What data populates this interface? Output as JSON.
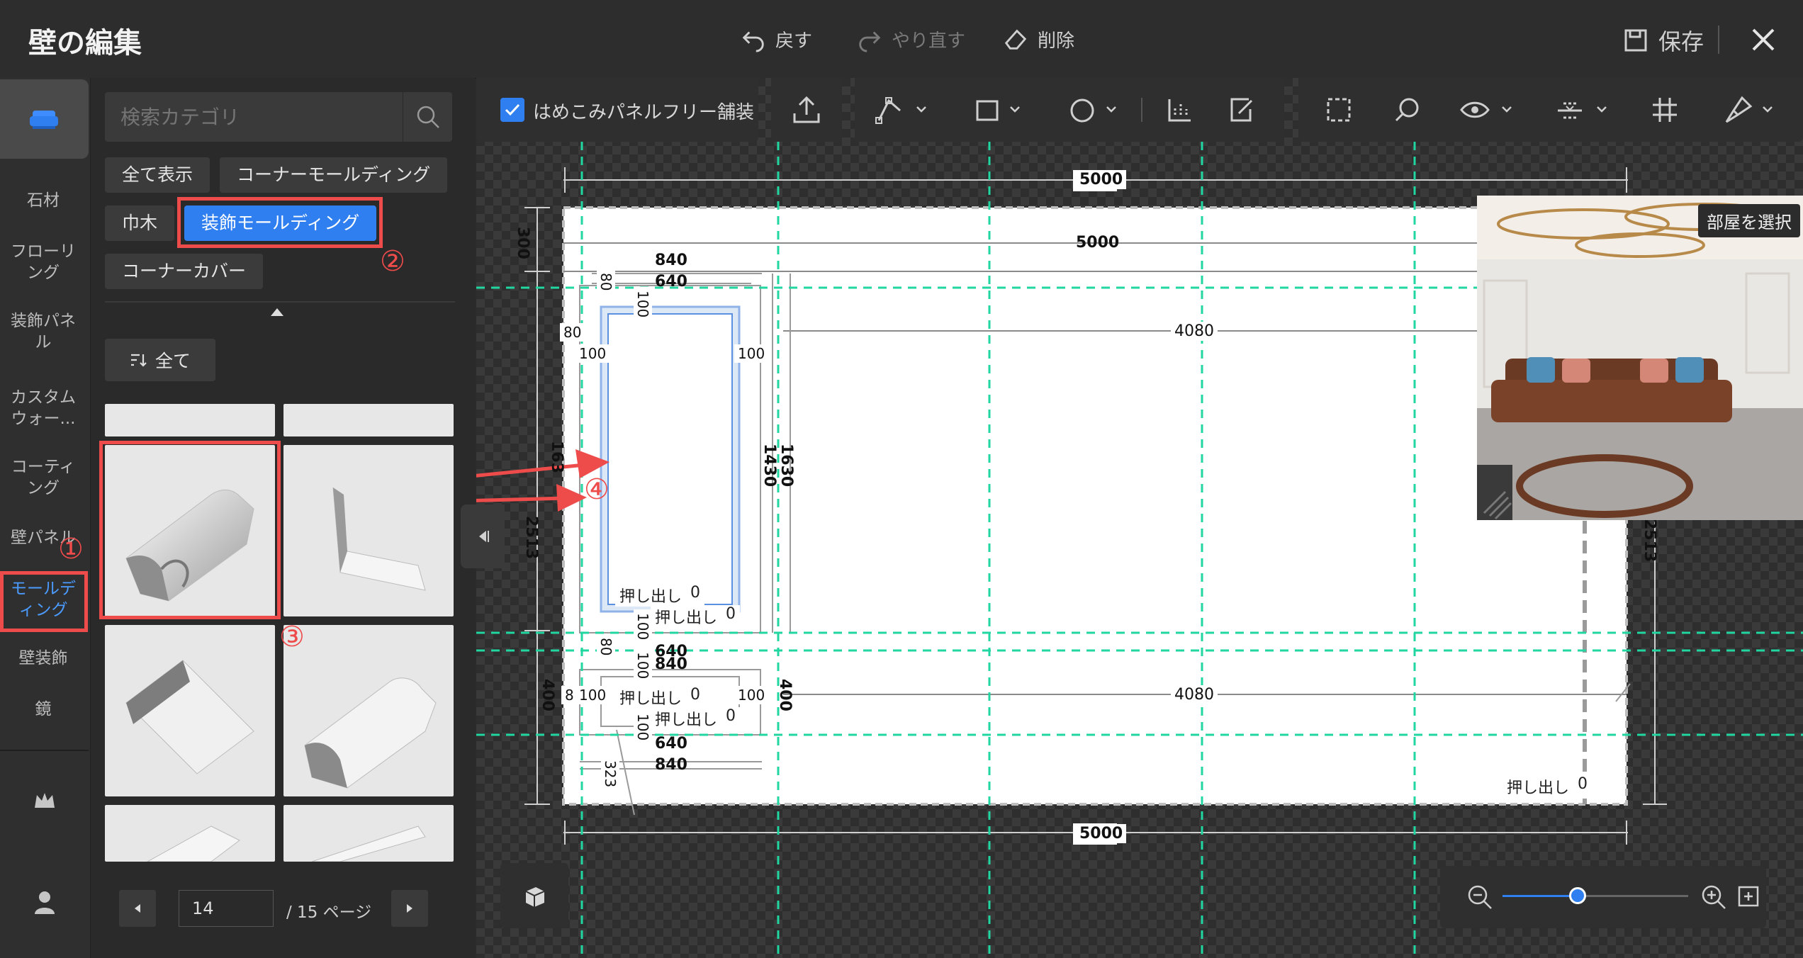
{
  "header": {
    "title": "壁の編集",
    "undo_label": "戻す",
    "redo_label": "やり直す",
    "delete_label": "削除",
    "save_label": "保存"
  },
  "rail": {
    "items": [
      {
        "label": "石材"
      },
      {
        "label": "フローリ\nング"
      },
      {
        "label": "装飾パネ\nル"
      },
      {
        "label": "カスタム\nウォー..."
      },
      {
        "label": "コーティ\nング"
      },
      {
        "label": "壁パネル"
      },
      {
        "label": "モールデ\nィング"
      },
      {
        "label": "壁装飾"
      },
      {
        "label": "鏡"
      }
    ],
    "active_index": 6
  },
  "panel": {
    "search_placeholder": "検索カテゴリ",
    "chips": [
      "全て表示",
      "コーナーモールディング",
      "巾木",
      "装飾モールディング",
      "コーナーカバー"
    ],
    "selected_chip": "装飾モールディング",
    "sort_label": "全て",
    "pager": {
      "current": "14",
      "total_label": "/ 15 ページ"
    }
  },
  "toolbar": {
    "checkbox_label": "はめこみパネルフリー舗装",
    "checkbox_checked": true
  },
  "canvas": {
    "select_room_label": "部屋を選択",
    "dimensions": {
      "top_width": "5000",
      "inner_width": "5000",
      "bottom_width": "5000",
      "frame_outer": "840",
      "frame_inner": "640",
      "right_span_top": "4080",
      "right_span_bottom": "4080",
      "left_300": "300",
      "left_2513": "2513",
      "right_2513": "2513",
      "left_400": "400",
      "right_400": "400",
      "v_1630": "1630",
      "v_1430": "1430",
      "v_1630_left": "163",
      "m80": "80",
      "m100": "100",
      "m323": "323",
      "m8": "8"
    },
    "extrude_label": "押し出し",
    "extrude_value": "0"
  },
  "annotations": {
    "step1": "①",
    "step2": "②",
    "step3": "③",
    "step4": "④"
  },
  "colors": {
    "accent": "#2f7ff0",
    "annotation": "#ee4b4b",
    "guide": "#21d6a0"
  }
}
